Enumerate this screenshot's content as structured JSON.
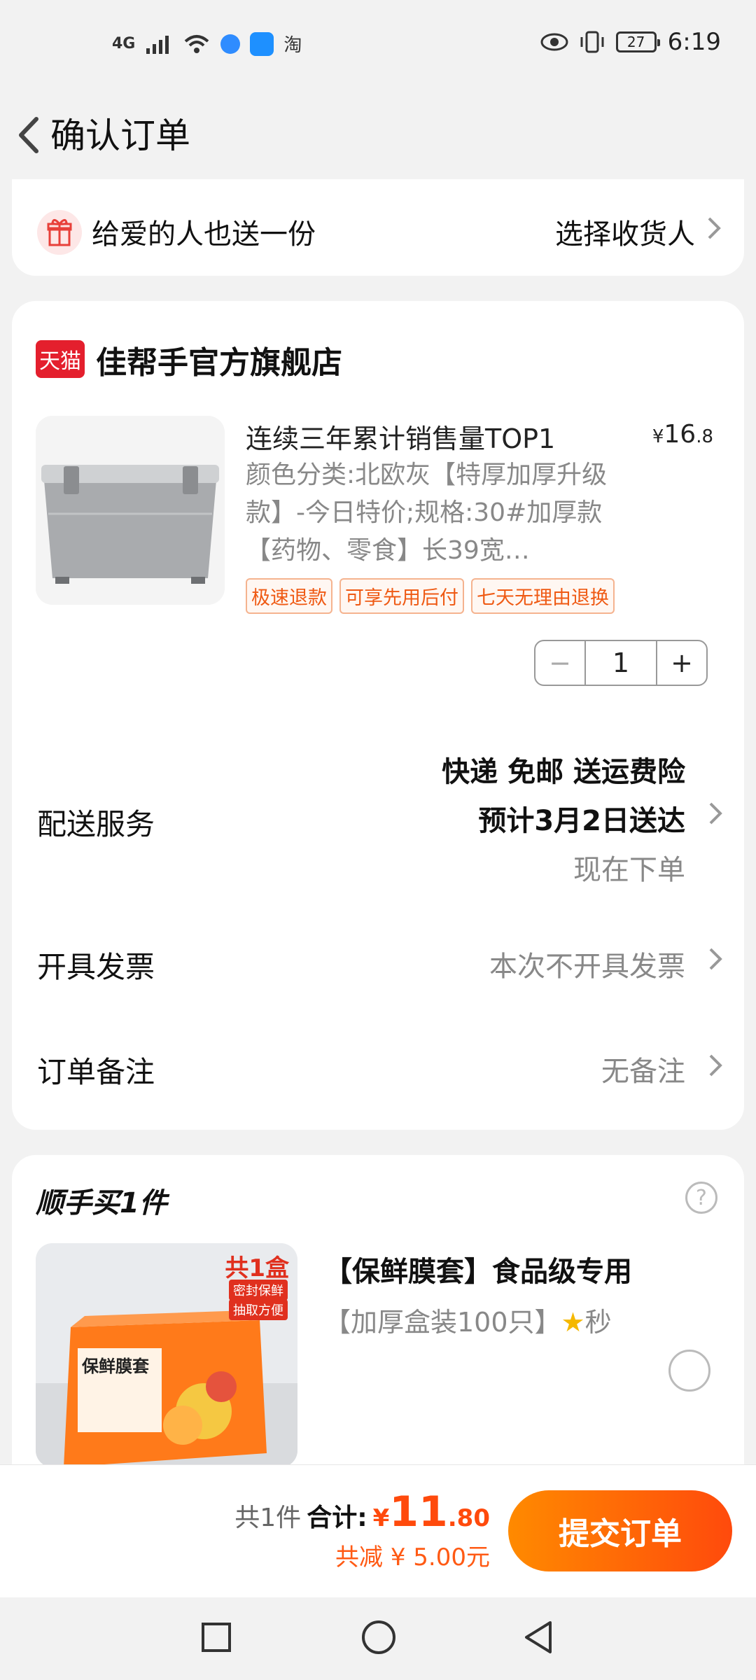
{
  "status": {
    "network": "4G",
    "battery": "27",
    "time": "6:19"
  },
  "header": {
    "title": "确认订单"
  },
  "gift": {
    "text": "给爱的人也送一份",
    "action": "选择收货人"
  },
  "store": {
    "badge": "天猫",
    "name": "佳帮手官方旗舰店",
    "product": {
      "title": "连续三年累计销售量TOP1",
      "price_symbol": "¥",
      "price_int": "16",
      "price_dec": ".8",
      "desc": "颜色分类:北欧灰【特厚加厚升级款】-今日特价;规格:30#加厚款【药物、零食】长39宽…",
      "tags": [
        "极速退款",
        "可享先用后付",
        "七天无理由退换"
      ],
      "quantity": "1"
    },
    "shipping": {
      "label": "配送服务",
      "line1": "快递 免邮 送运费险",
      "line2": "预计3月2日送达",
      "line3": "现在下单"
    },
    "invoice": {
      "label": "开具发票",
      "value": "本次不开具发票"
    },
    "note": {
      "label": "订单备注",
      "value": "无备注"
    }
  },
  "addon": {
    "title": "顺手买1件",
    "help": "?",
    "product": {
      "name": "【保鲜膜套】食品级专用",
      "desc": "【加厚盒装100只】",
      "star": "★",
      "desc_tail": "秒",
      "img_badge": "共1盒",
      "img_tag1": "密封保鲜",
      "img_tag2": "抽取方便",
      "img_box_text": "保鲜膜套"
    }
  },
  "bottom": {
    "count": "共1件",
    "total_label": "合计:",
    "total_symbol": "¥",
    "total_int": "11",
    "total_dec": ".80",
    "discount": "共减 ¥ 5.00元",
    "submit": "提交订单"
  }
}
